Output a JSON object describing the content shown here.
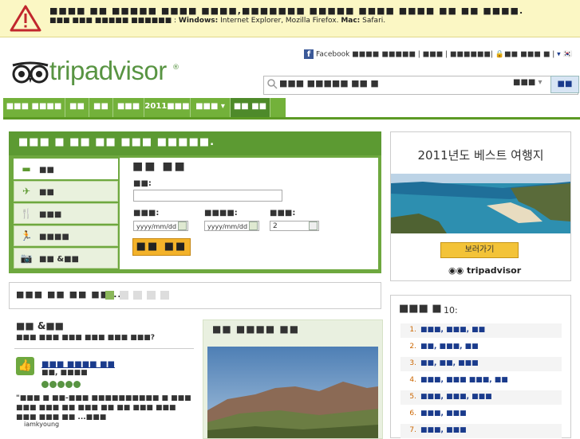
{
  "warning": {
    "line1": "■■■■ ■■ ■■■■■ ■■■■ ■■■■,■■■■■■■ ■■■■■ ■■■■ ■■■■ ■■ ■■ ■■■■.",
    "line2_prefix": "■■■ ■■■ ■■■■■ ■■■■■■ :",
    "windows_label": "Windows:",
    "windows_browsers": "Internet Explorer, Mozilla Firefox.",
    "mac_label": "Mac:",
    "mac_browsers": "Safari."
  },
  "logo": {
    "text": "tripadvisor",
    "reg": "®"
  },
  "toplinks": {
    "facebook": "Facebook",
    "link1": "■■■■ ■■■■■",
    "link2": "■■■",
    "link3": "■■■■■■",
    "link4": "■■ ■■■ ■",
    "menu_icon": "▾",
    "flag": "🇰🇷"
  },
  "search": {
    "value": "■■■ ■■■■■ ■■ ■",
    "scope": "■■■",
    "button": "■■"
  },
  "nav": [
    {
      "label": "■■■ ■■■■",
      "w": 78
    },
    {
      "label": "■■",
      "w": 30
    },
    {
      "label": "■■",
      "w": 30
    },
    {
      "label": "■■■",
      "w": 39
    },
    {
      "label": "2011■■■",
      "w": 58
    },
    {
      "label": "■■■ ▾",
      "w": 50
    },
    {
      "label": "■■ ■■",
      "w": 50
    }
  ],
  "search_panel": {
    "heading": "■■■ ■ ■■ ■■ ■■■ ■■■■■.",
    "tabs": [
      {
        "icon": "bed-icon",
        "glyph": "▬",
        "label": "■■",
        "active": true
      },
      {
        "icon": "plane-icon",
        "glyph": "✈",
        "label": "■■",
        "active": false
      },
      {
        "icon": "restaurant-icon",
        "glyph": "🍴",
        "label": "■■■",
        "active": false
      },
      {
        "icon": "activity-icon",
        "glyph": "🏃",
        "label": "■■■■",
        "active": false
      },
      {
        "icon": "camera-icon",
        "glyph": "📷",
        "label": "■■ &■■",
        "active": false
      }
    ],
    "form_title": "■■ ■■",
    "dest_label": "■■:",
    "checkin_label": "■■■:",
    "checkin_value": "yyyy/mm/dd",
    "checkout_label": "■■■■:",
    "checkout_value": "yyyy/mm/dd",
    "guests_label": "■■■:",
    "guests_value": "2",
    "find_button": "■■ ■■"
  },
  "promo": {
    "text": "■■■ ■■ ■■ ■■..."
  },
  "reviews": {
    "title": "■■ &■■",
    "subtitle": "■■■ ■■■ ■■■ ■■■ ■■■ ■■■?",
    "link": "■■■ ■■■■ ■■",
    "location": "■■, ■■■■",
    "rating": 5,
    "body": "\"■■■ ■ ■■-■■■ ■■■■■■■■■■ ■ ■■■ ■■■ ■■■ ■■ ■■■ ■■ ■■ ■■■ ■■■ ■■■ ■■■ ■■ ...■■■",
    "by": "iamkyoung"
  },
  "featured": {
    "title": "■■ ■■■■ ■■"
  },
  "ad": {
    "title": "2011년도 베스트 여행지",
    "button": "보러가기",
    "logo_text": "tripadvisor"
  },
  "top10": {
    "title": "■■■ ■",
    "count": "10:",
    "items": [
      {
        "n": "1.",
        "t": "■■■, ■■■, ■■"
      },
      {
        "n": "2.",
        "t": "■■, ■■■, ■■"
      },
      {
        "n": "3.",
        "t": "■■, ■■, ■■■"
      },
      {
        "n": "4.",
        "t": "■■■, ■■■ ■■■, ■■"
      },
      {
        "n": "5.",
        "t": "■■■, ■■■, ■■■"
      },
      {
        "n": "6.",
        "t": "■■■, ■■■"
      },
      {
        "n": "7.",
        "t": "■■■, ■■■"
      }
    ]
  },
  "colors": {
    "brand_green": "#589442",
    "nav_green": "#73b13a",
    "warning_bg": "#fbf7c4",
    "button_orange": "#f3b22a",
    "link_blue": "#1a3b8c"
  }
}
